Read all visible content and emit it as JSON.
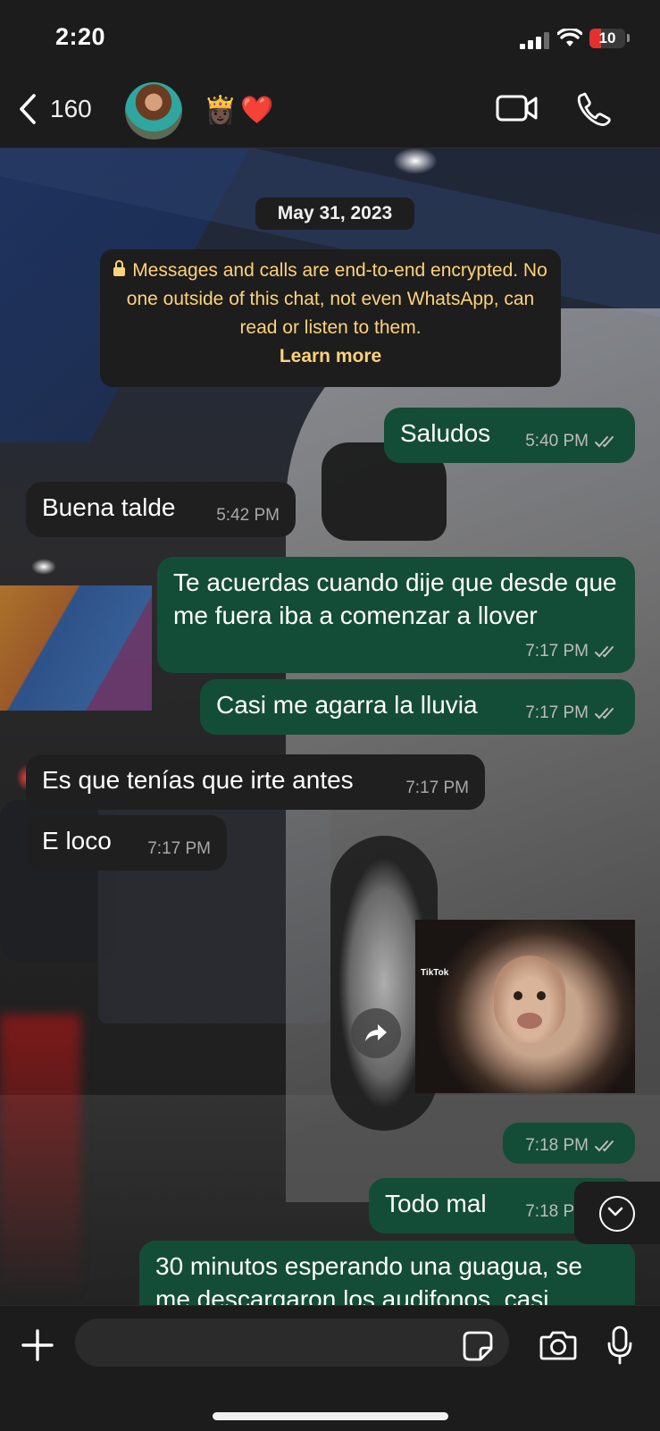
{
  "status_bar": {
    "time": "2:20",
    "battery": "10",
    "battery_level": 0.1
  },
  "header": {
    "back_count": "160",
    "contact_emojis": "👸🏿❤️"
  },
  "chat": {
    "date": "May 31, 2023",
    "encryption_notice": "Messages and calls are end-to-end encrypted. No one outside of this chat, not even WhatsApp, can read or listen to them.",
    "learn_more": "Learn more",
    "messages": [
      {
        "direction": "out",
        "text": "Saludos",
        "time": "5:40 PM",
        "read": true
      },
      {
        "direction": "in",
        "text": "Buena talde",
        "time": "5:42 PM"
      },
      {
        "direction": "out",
        "text": "Te acuerdas cuando dije que desde que me fuera iba a comenzar a llover",
        "time": "7:17 PM",
        "read": true
      },
      {
        "direction": "out",
        "text": "Casi me agarra la lluvia",
        "time": "7:17 PM",
        "read": true
      },
      {
        "direction": "in",
        "text": "Es que tenías que irte antes",
        "time": "7:17 PM"
      },
      {
        "direction": "in",
        "text": "E loco",
        "time": "7:17 PM"
      },
      {
        "direction": "out",
        "type": "video",
        "watermark": "TikTok",
        "time": "7:18 PM",
        "read": true
      },
      {
        "direction": "out",
        "text": "Todo mal",
        "time": "7:18 PM",
        "read": true
      },
      {
        "direction": "out",
        "text": "30 minutos esperando una guagua, se me descargaron los audifonos, casi",
        "time": "",
        "read": true
      }
    ]
  },
  "composer": {
    "placeholder": ""
  },
  "icons": {
    "back": "chevron-left-icon",
    "video": "video-camera-icon",
    "call": "phone-icon",
    "share": "forward-arrow-icon",
    "scroll_down": "chevron-down-circle-icon",
    "plus": "plus-icon",
    "sticker": "sticker-icon",
    "camera": "camera-icon",
    "mic": "microphone-icon",
    "lock": "lock-icon",
    "read_receipt": "double-check-icon"
  },
  "colors": {
    "outgoing_bubble": "#144d37",
    "incoming_bubble": "#1f1f1f",
    "notice_text": "#ffd279",
    "battery_low": "#e3312f"
  }
}
